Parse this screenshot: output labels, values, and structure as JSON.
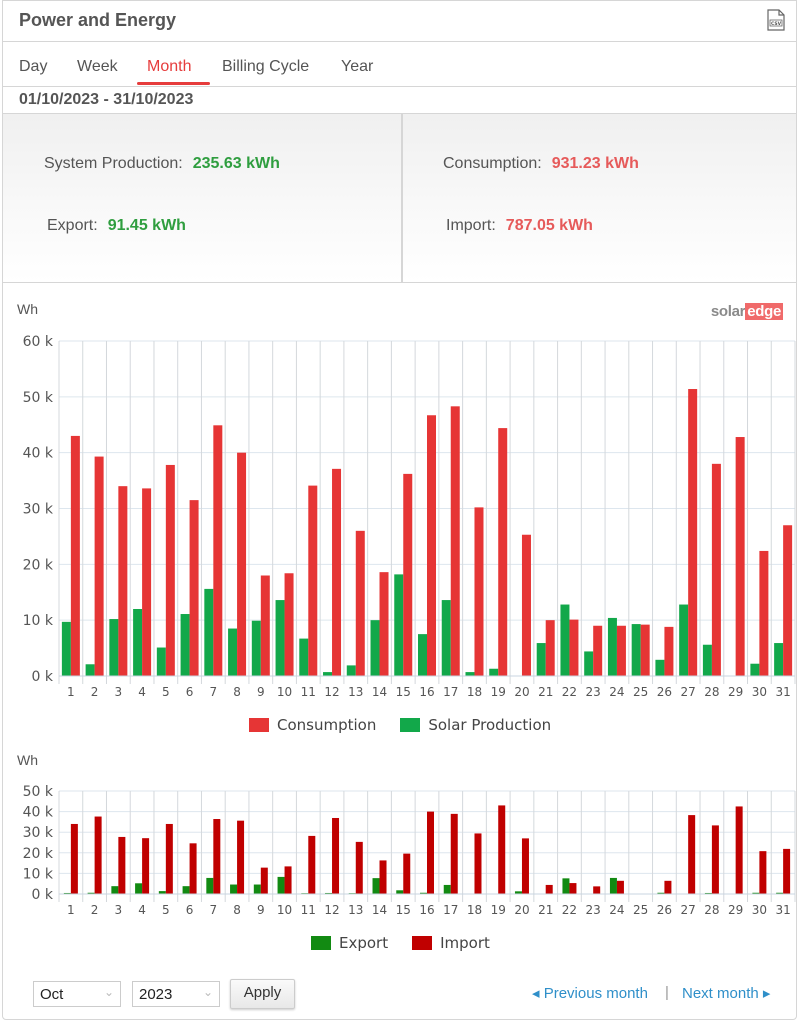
{
  "header": {
    "title": "Power and Energy",
    "export_icon": "csv-file-icon"
  },
  "tabs": [
    {
      "label": "Day",
      "active": false
    },
    {
      "label": "Week",
      "active": false
    },
    {
      "label": "Month",
      "active": true
    },
    {
      "label": "Billing Cycle",
      "active": false
    },
    {
      "label": "Year",
      "active": false
    }
  ],
  "date_range": "01/10/2023 - 31/10/2023",
  "summary": {
    "system_production": {
      "label": "System Production:",
      "value": "235.63 kWh"
    },
    "export": {
      "label": "Export:",
      "value": "91.45 kWh"
    },
    "consumption": {
      "label": "Consumption:",
      "value": "931.23 kWh"
    },
    "import": {
      "label": "Import:",
      "value": "787.05 kWh"
    }
  },
  "logo": {
    "part1": "solar",
    "part2": "edge"
  },
  "colors": {
    "consumption": "#e63535",
    "solar_production": "#12a84a",
    "export": "#128a12",
    "import": "#c00000",
    "accent": "#e63c3c",
    "link": "#2f8fc9"
  },
  "chart_data": [
    {
      "type": "bar",
      "title": "",
      "ylabel": "Wh",
      "xlabel": "",
      "ylim": [
        0,
        60000
      ],
      "yticks": [
        "0 k",
        "10 k",
        "20 k",
        "30 k",
        "40 k",
        "50 k",
        "60 k"
      ],
      "grid": true,
      "legend_position": "bottom",
      "categories": [
        "1",
        "2",
        "3",
        "4",
        "5",
        "6",
        "7",
        "8",
        "9",
        "10",
        "11",
        "12",
        "13",
        "14",
        "15",
        "16",
        "17",
        "18",
        "19",
        "20",
        "21",
        "22",
        "23",
        "24",
        "25",
        "26",
        "27",
        "28",
        "29",
        "30",
        "31"
      ],
      "series": [
        {
          "name": "Consumption",
          "values": [
            43000,
            39300,
            34000,
            33600,
            37800,
            31500,
            44900,
            40000,
            18000,
            18400,
            34100,
            37100,
            26000,
            18600,
            36200,
            46700,
            48300,
            30200,
            44400,
            25300,
            10000,
            10100,
            9000,
            9000,
            9200,
            8800,
            51400,
            38000,
            42800,
            22400,
            27000
          ]
        },
        {
          "name": "Solar Production",
          "values": [
            9700,
            2100,
            10200,
            12000,
            5100,
            11100,
            15600,
            8500,
            9900,
            13600,
            6700,
            700,
            1900,
            10000,
            18200,
            7500,
            13600,
            700,
            1300,
            0,
            5900,
            12800,
            4400,
            10400,
            9300,
            2900,
            12800,
            5600,
            0,
            2200,
            5900
          ]
        }
      ]
    },
    {
      "type": "bar",
      "title": "",
      "ylabel": "Wh",
      "xlabel": "",
      "ylim": [
        0,
        50000
      ],
      "yticks": [
        "0 k",
        "10 k",
        "20 k",
        "30 k",
        "40 k",
        "50 k"
      ],
      "grid": true,
      "legend_position": "bottom",
      "categories": [
        "1",
        "2",
        "3",
        "4",
        "5",
        "6",
        "7",
        "8",
        "9",
        "10",
        "11",
        "12",
        "13",
        "14",
        "15",
        "16",
        "17",
        "18",
        "19",
        "20",
        "21",
        "22",
        "23",
        "24",
        "25",
        "26",
        "27",
        "28",
        "29",
        "30",
        "31"
      ],
      "series": [
        {
          "name": "Export",
          "values": [
            500,
            600,
            3800,
            5200,
            1400,
            3800,
            7800,
            4600,
            4600,
            8300,
            400,
            500,
            400,
            7700,
            1800,
            600,
            4400,
            0,
            0,
            1300,
            0,
            7600,
            0,
            7800,
            0,
            600,
            0,
            500,
            0,
            600,
            600
          ]
        },
        {
          "name": "Import",
          "values": [
            34000,
            37600,
            27700,
            27100,
            34000,
            24600,
            36400,
            35600,
            12800,
            13400,
            28200,
            36900,
            25300,
            16300,
            19600,
            40000,
            38900,
            29400,
            43000,
            27000,
            4400,
            5300,
            3700,
            6400,
            0,
            6400,
            38300,
            33300,
            42500,
            20800,
            21900
          ]
        }
      ]
    }
  ],
  "footer": {
    "month_select": "Oct",
    "year_select": "2023",
    "apply_label": "Apply",
    "previous_label": "Previous month",
    "next_label": "Next month",
    "separator": "|"
  }
}
